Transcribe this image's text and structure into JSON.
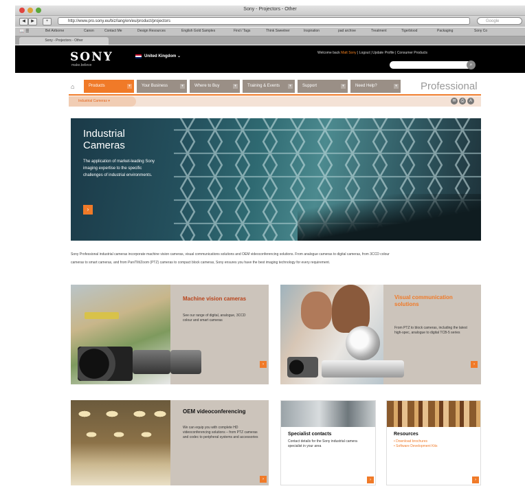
{
  "browser": {
    "window_title": "Sony - Projectors - Other",
    "url": "http://www.pro.sony.eu/biz/lang/en/eu/product/projectors",
    "search_placeholder": "Google",
    "bookmarks": [
      "Bel Airborne",
      "Canon",
      "Contact Me",
      "Design Resources",
      "English Gold Samples",
      "Find / Tags",
      "Think Sweetner",
      "Inspiration",
      "pad archive",
      "Treatment",
      "Tigerblood",
      "Packaging",
      "Sony Co"
    ],
    "tab_label": "Sony - Projectors - Other"
  },
  "header": {
    "logo": "SONY",
    "tagline": "make.believe",
    "region": "United Kingdom",
    "welcome_prefix": "Welcome back",
    "user": "Matt Sony",
    "welcome_links": "| Logout | Update Profile | Consumer Products"
  },
  "nav": {
    "items": [
      {
        "label": "Products",
        "color": "#f07a28"
      },
      {
        "label": "Your Business",
        "color": "#9a8f86"
      },
      {
        "label": "Where to Buy",
        "color": "#9a8f86"
      },
      {
        "label": "Training & Events",
        "color": "#9a8f86"
      },
      {
        "label": "Support",
        "color": "#9a8f86"
      },
      {
        "label": "Need Help?",
        "color": "#9a8f86"
      }
    ],
    "brand": "Professional",
    "subnav_item": "Industrial Cameras"
  },
  "hero": {
    "title": "Industrial Cameras",
    "text": "The application of market-leading Sony imaging expertise to the specific challenges of industrial environments."
  },
  "intro": "Sony Professional industrial cameras incorporate machine vision cameras, visual communications solutions and OEM videoconferencing solutions. From analogue cameras to digital cameras, from 3CCD colour cameras to smart cameras, and from Pan/Tilt/Zoom (PTZ) cameras to compact block cameras, Sony ensures you have the best imaging technology for every requirement.",
  "cards": {
    "machine_vision": {
      "title": "Machine vision cameras",
      "text": "See our range of digital, analogue, 3CCD colour and smart cameras"
    },
    "visual_comm": {
      "title": "Visual communication solutions",
      "text": "From PTZ to block cameras, including the latest high-spec, analogue to digital TCB-5 series"
    },
    "oem": {
      "title": "OEM videoconferencing",
      "text": "We can equip you with complete HD videoconferencing solutions – from PTZ cameras and codec to peripheral systems and accessories"
    },
    "specialist": {
      "title": "Specialist contacts",
      "text": "Contact details for the Sony industrial camera specialist in your area"
    },
    "resources": {
      "title": "Resources",
      "link1": "Download brochures",
      "link2": "Software Development Kits"
    }
  },
  "colors": {
    "accent": "#f07a28",
    "card_bg": "#ccc4bb",
    "header_bg": "#000000"
  }
}
